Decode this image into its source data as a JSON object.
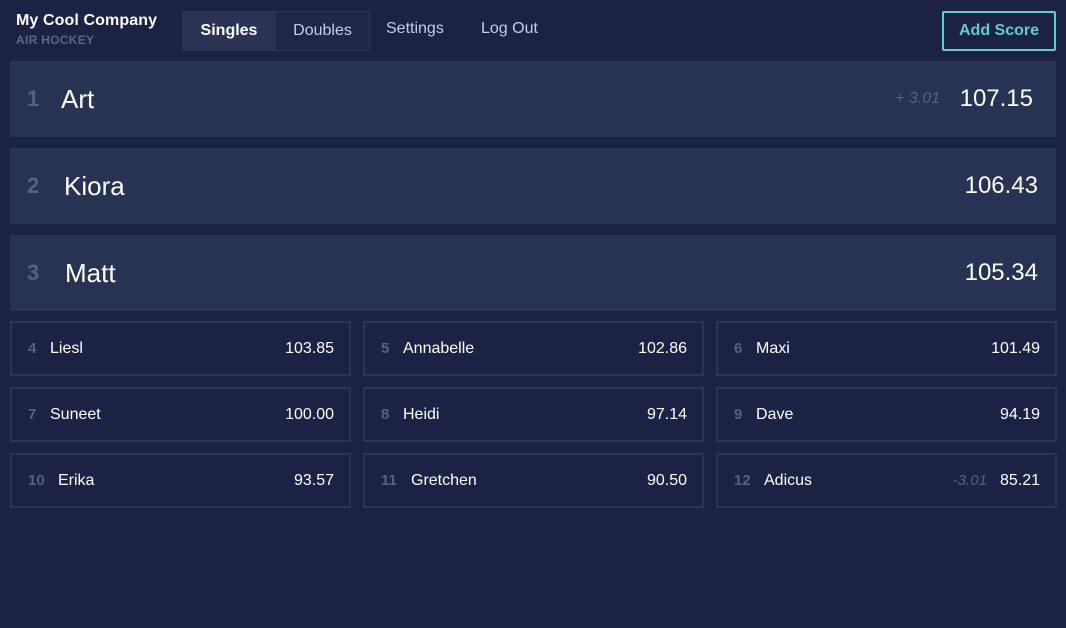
{
  "brand": {
    "name": "My Cool Company",
    "subtitle": "AIR HOCKEY"
  },
  "nav": {
    "tabs": [
      {
        "label": "Singles",
        "active": true
      },
      {
        "label": "Doubles",
        "active": false
      }
    ],
    "links": [
      "Settings",
      "Log Out"
    ],
    "add_score": "Add Score"
  },
  "colors": {
    "background": "#1c2244",
    "card": "#283354",
    "accent": "#5ad0d0",
    "muted": "#566184"
  },
  "top_players": [
    {
      "rank": "1",
      "name": "Art",
      "delta": "+ 3.01",
      "score": "107.15"
    },
    {
      "rank": "2",
      "name": "Kiora",
      "delta": "",
      "score": "106.43"
    },
    {
      "rank": "3",
      "name": "Matt",
      "delta": "",
      "score": "105.34"
    }
  ],
  "players": [
    {
      "rank": "4",
      "name": "Liesl",
      "delta": "",
      "score": "103.85"
    },
    {
      "rank": "5",
      "name": "Annabelle",
      "delta": "",
      "score": "102.86"
    },
    {
      "rank": "6",
      "name": "Maxi",
      "delta": "",
      "score": "101.49"
    },
    {
      "rank": "7",
      "name": "Suneet",
      "delta": "",
      "score": "100.00"
    },
    {
      "rank": "8",
      "name": "Heidi",
      "delta": "",
      "score": "97.14"
    },
    {
      "rank": "9",
      "name": "Dave",
      "delta": "",
      "score": "94.19"
    },
    {
      "rank": "10",
      "name": "Erika",
      "delta": "",
      "score": "93.57"
    },
    {
      "rank": "11",
      "name": "Gretchen",
      "delta": "",
      "score": "90.50"
    },
    {
      "rank": "12",
      "name": "Adicus",
      "delta": "-3.01",
      "score": "85.21"
    }
  ]
}
